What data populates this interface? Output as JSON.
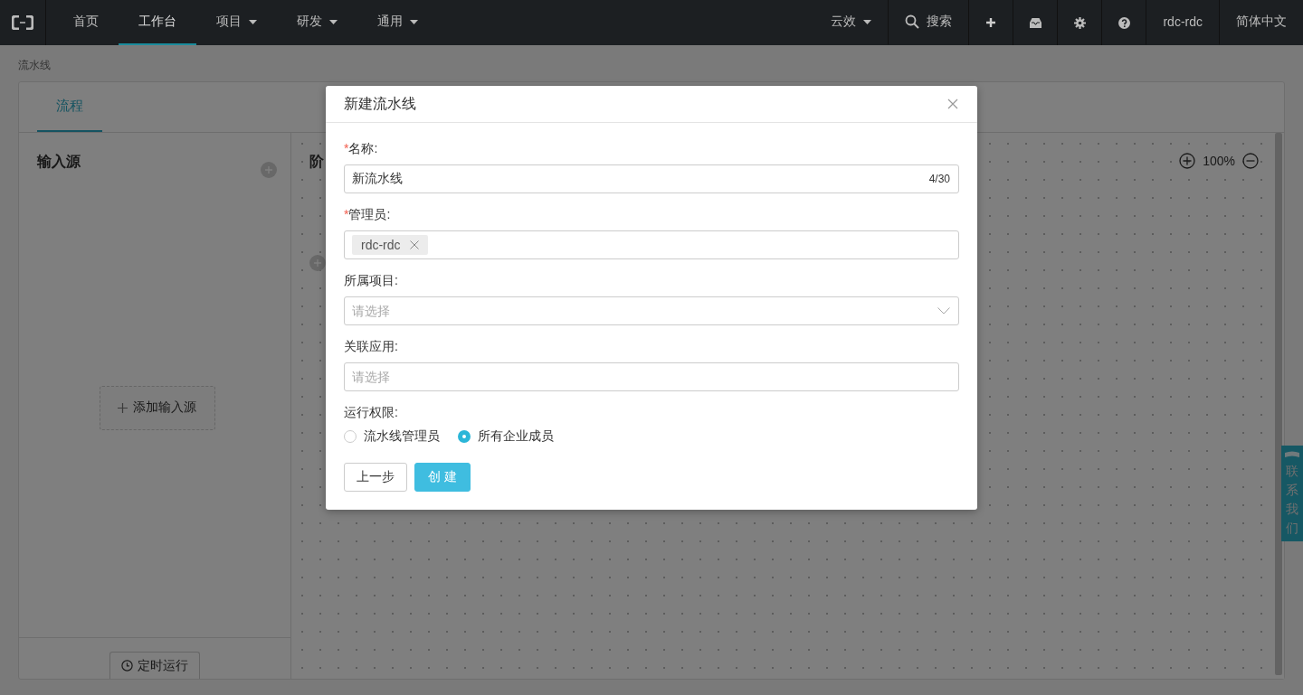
{
  "top_nav": {
    "items": [
      {
        "label": "首页",
        "selected": false,
        "has_menu": false
      },
      {
        "label": "工作台",
        "selected": true,
        "has_menu": false
      },
      {
        "label": "项目",
        "selected": false,
        "has_menu": true
      },
      {
        "label": "研发",
        "selected": false,
        "has_menu": true
      },
      {
        "label": "通用",
        "selected": false,
        "has_menu": true
      }
    ],
    "org": {
      "label": "云效",
      "has_menu": true
    },
    "search": {
      "label": "搜索"
    },
    "user": "rdc-rdc",
    "language": "简体中文"
  },
  "breadcrumb": "流水线",
  "tabs": [
    {
      "label": "流程",
      "selected": true
    }
  ],
  "sources_panel": {
    "title": "输入源",
    "add_button": "添加输入源",
    "schedule_button": "定时运行"
  },
  "canvas": {
    "stage_title": "阶",
    "zoom": "100%"
  },
  "contact_tab": "联系我们",
  "dialog": {
    "title": "新建流水线",
    "fields": [
      {
        "kind": "text",
        "label": "名称:",
        "required_mark": "*",
        "value": "新流水线",
        "counter": "4/30"
      },
      {
        "kind": "tags",
        "label": "管理员:",
        "required_mark": "*",
        "tags": [
          "rdc-rdc"
        ]
      },
      {
        "kind": "select",
        "label": "所属项目:",
        "placeholder": "请选择"
      },
      {
        "kind": "input",
        "label": "关联应用:",
        "placeholder": "请选择"
      },
      {
        "kind": "radio",
        "label": "运行权限:",
        "options": [
          {
            "label": "流水线管理员",
            "selected": false
          },
          {
            "label": "所有企业成员",
            "selected": true
          }
        ]
      }
    ],
    "back_button": "上一步",
    "create_button": "创 建"
  }
}
